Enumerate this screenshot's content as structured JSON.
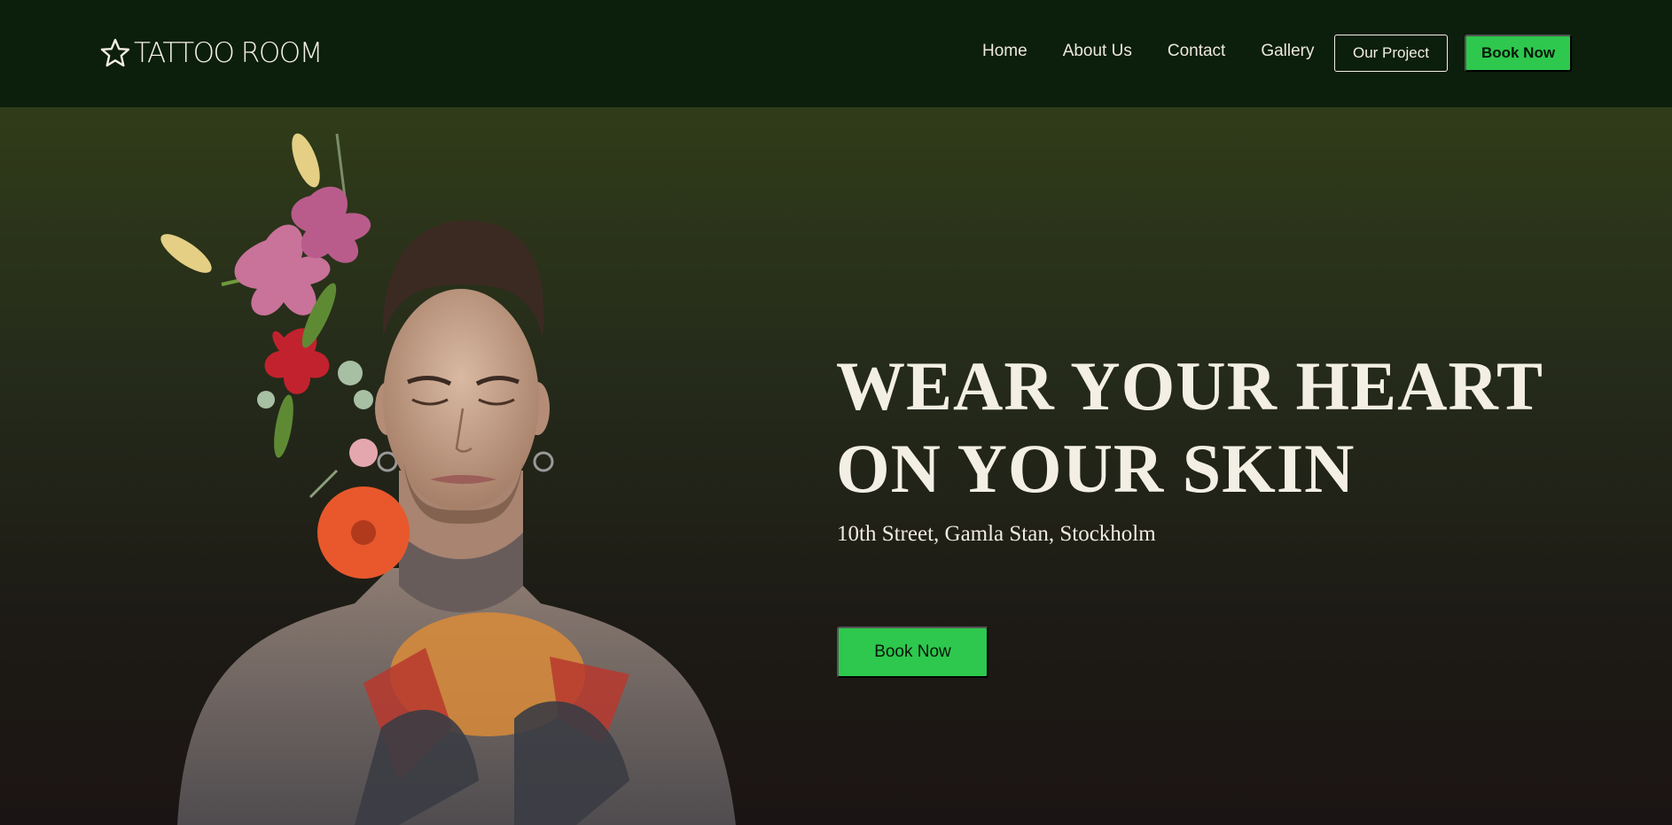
{
  "header": {
    "logo_text": "TATTOO ROOM",
    "logo_icon": "star-outline-icon",
    "nav": [
      {
        "label": "Home"
      },
      {
        "label": "About Us"
      },
      {
        "label": "Contact"
      },
      {
        "label": "Gallery"
      }
    ],
    "project_button": "Our Project",
    "book_button": "Book Now"
  },
  "hero": {
    "headline_line1": "WEAR YOUR HEART",
    "headline_line2": "ON YOUR SKIN",
    "address": "10th Street, Gamla Stan, Stockholm",
    "cta_button": "Book Now",
    "image_subject": "tattooed man with flowers portrait"
  },
  "colors": {
    "nav_bg": "#0c1e0c",
    "accent_green": "#2dc84d",
    "text_cream": "#f3efe4",
    "hero_top": "#303c19",
    "hero_bottom": "#1b1414"
  }
}
